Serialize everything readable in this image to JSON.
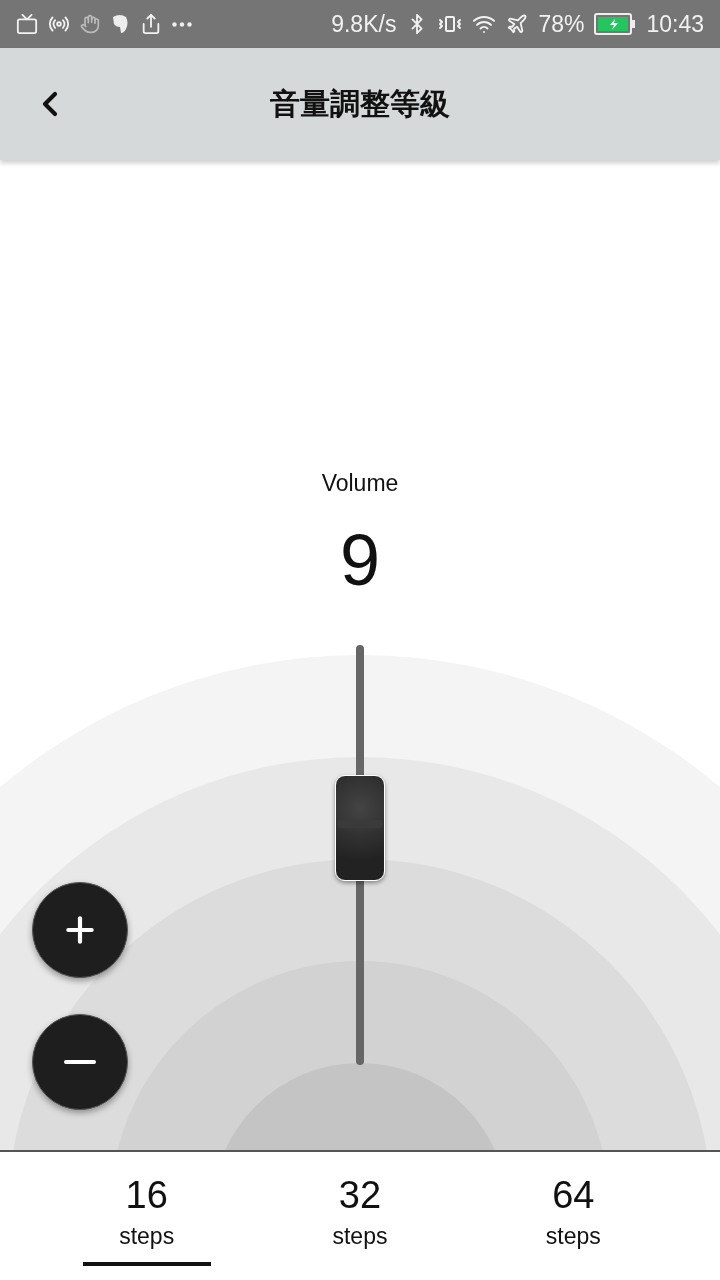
{
  "status_bar": {
    "network_speed": "9.8K/s",
    "battery": "78%",
    "time": "10:43"
  },
  "header": {
    "title": "音量調整等級"
  },
  "volume": {
    "label": "Volume",
    "value": "9",
    "level": 0.5625
  },
  "step_tabs": [
    {
      "value": "16",
      "unit": "steps",
      "selected": true
    },
    {
      "value": "32",
      "unit": "steps",
      "selected": false
    },
    {
      "value": "64",
      "unit": "steps",
      "selected": false
    }
  ]
}
